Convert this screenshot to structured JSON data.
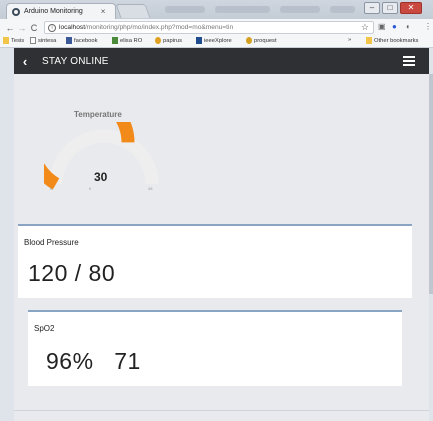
{
  "browser": {
    "tab_title": "Arduino Monitoring",
    "tab_close": "×",
    "url_host": "localhost",
    "url_path": "/monitoring/php/mo/index.php?mod=mo&menu=tin",
    "bookmarks": [
      {
        "label": "Tesis",
        "icon": "folder-icon",
        "color": "#f2c548"
      },
      {
        "label": "sintesa",
        "icon": "page-icon",
        "color": "#ffffff"
      },
      {
        "label": "facebook",
        "icon": "facebook-icon",
        "color": "#3b5998"
      },
      {
        "label": "elisa RO",
        "icon": "page-icon",
        "color": "#4a8a3a"
      },
      {
        "label": "papirus",
        "icon": "papirus-icon",
        "color": "#e0a020"
      },
      {
        "label": "ieeeXplore",
        "icon": "ieee-icon",
        "color": "#1e4c8f"
      },
      {
        "label": "proquest",
        "icon": "proquest-icon",
        "color": "#d4a020"
      }
    ],
    "bookmarks_overflow": "»",
    "other_bookmarks": "Other bookmarks"
  },
  "app": {
    "title": "STAY ONLINE"
  },
  "gauge": {
    "title": "Temperature",
    "value": "30",
    "value_num": 30,
    "min": 0,
    "max": 45,
    "fill_color": "#f28a1a",
    "track_color": "#eeeeee",
    "tick_labels": [
      "0",
      "0",
      "45"
    ]
  },
  "blood_pressure": {
    "label": "Blood Pressure",
    "value": "120 / 80"
  },
  "spo2": {
    "label": "SpO2",
    "value": "96%   71"
  }
}
